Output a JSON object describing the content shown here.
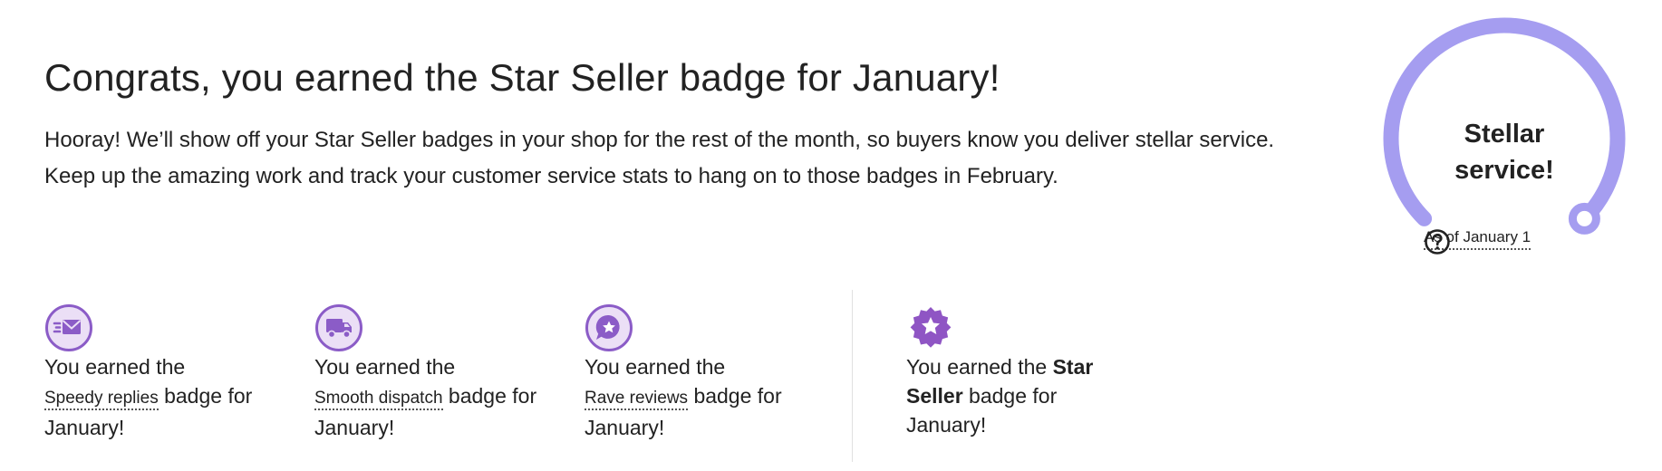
{
  "header": {
    "title": "Congrats, you earned the Star Seller badge for January!",
    "intro_line1": "Hooray! We’ll show off your Star Seller badges in your shop for the rest of the month, so buyers know you deliver stellar service.",
    "intro_line2": "Keep up the amazing work and track your customer service stats to hang on to those badges in February."
  },
  "gauge": {
    "line1": "Stellar",
    "line2": "service!",
    "as_of": "As of January 1",
    "arc_color": "#a59df0",
    "level_fraction": 1.0
  },
  "badges": [
    {
      "icon": "envelope-icon",
      "prefix": "You earned the",
      "name": "Speedy replies",
      "suffix": "badge for January!"
    },
    {
      "icon": "truck-icon",
      "prefix": "You earned the",
      "name": "Smooth dispatch",
      "suffix": "badge for January!"
    },
    {
      "icon": "star-chat-icon",
      "prefix": "You earned the",
      "name": "Rave reviews",
      "suffix": "badge for January!"
    },
    {
      "icon": "star-seller-icon",
      "prefix": "You earned the",
      "name": "Star Seller",
      "suffix": "badge for January!"
    }
  ],
  "colors": {
    "badge_purple": "#8b5cc7",
    "badge_fill": "#ebdff6",
    "star_seller_purple": "#8f55c4"
  }
}
